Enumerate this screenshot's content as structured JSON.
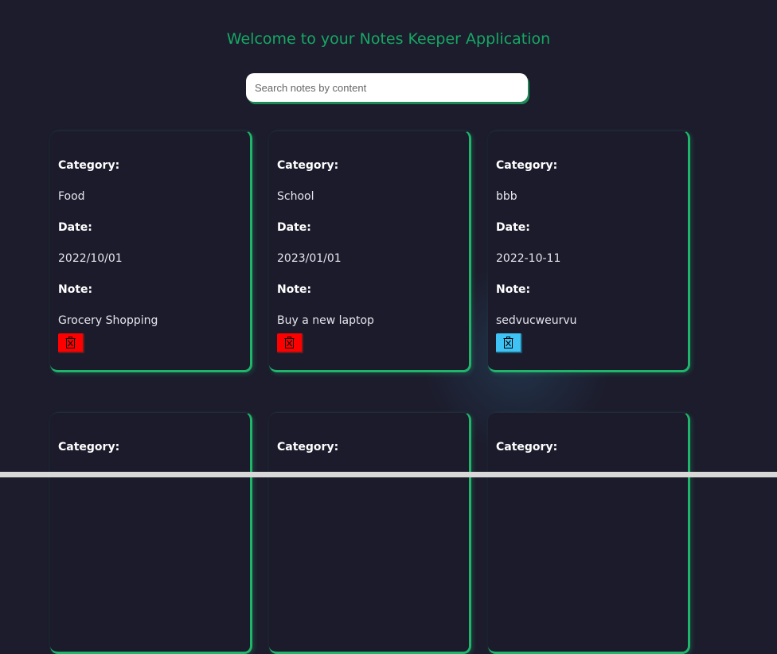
{
  "header": {
    "title": "Welcome to your Notes Keeper Application"
  },
  "search": {
    "placeholder": "Search notes by content",
    "value": ""
  },
  "labels": {
    "category": "Category:",
    "date": "Date:",
    "note": "Note:"
  },
  "notes": [
    {
      "category": "Food",
      "date": "2022/10/01",
      "note": "Grocery Shopping",
      "delete_color": "#fe0000",
      "delete_icon": "trash-icon"
    },
    {
      "category": "School",
      "date": "2023/01/01",
      "note": "Buy a new laptop",
      "delete_color": "#fe0000",
      "delete_icon": "trash-icon"
    },
    {
      "category": "bbb",
      "date": "2022-10-11",
      "note": "sedvucweurvu",
      "delete_color": "#3fc3f5",
      "delete_icon": "trash-icon"
    }
  ],
  "colors": {
    "background": "#1c1c2c",
    "accent": "#16a864",
    "card_border": "#1fb56b"
  }
}
